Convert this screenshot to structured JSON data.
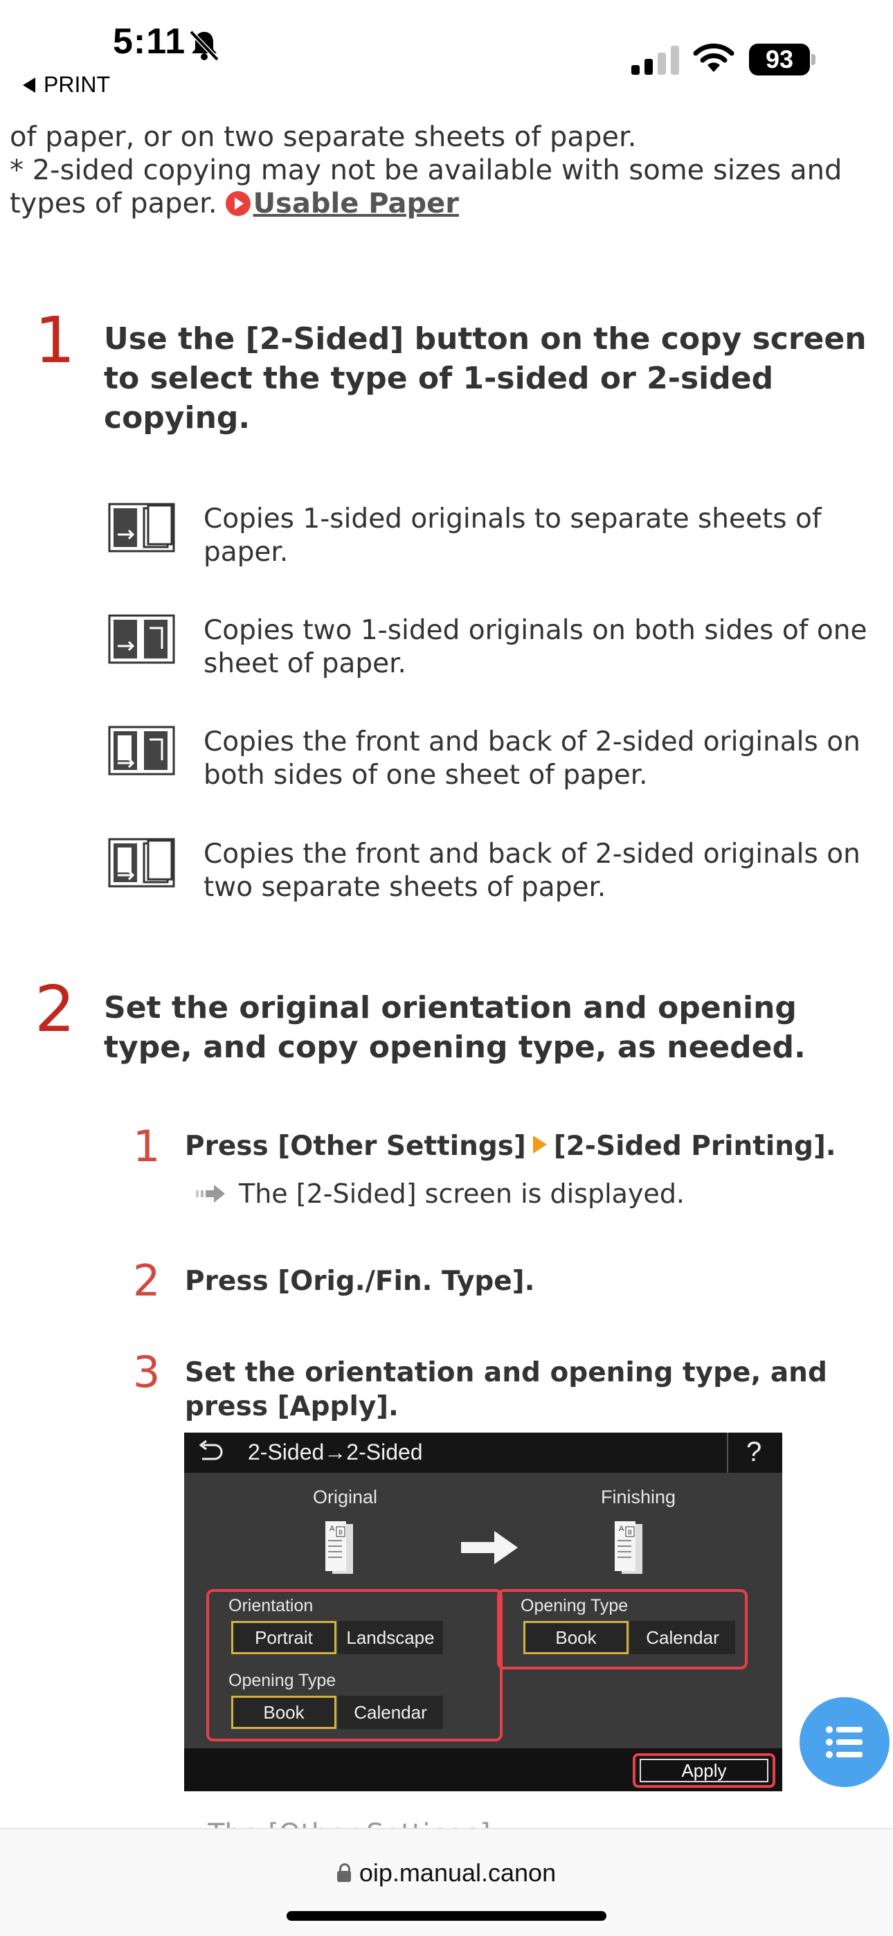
{
  "status_bar": {
    "time": "5:11",
    "back_label": "PRINT",
    "battery": "93"
  },
  "intro": {
    "line1": "of paper, or on two separate sheets of paper.",
    "line2": "* 2-sided copying may not be available with some sizes and types of paper.",
    "link": "Usable Paper"
  },
  "step1": {
    "number": "1",
    "title": "Use the [2-Sided] button on the copy screen to select the type of 1-sided or 2-sided copying.",
    "options": [
      {
        "icon": "1-to-1-sided-icon",
        "text": "Copies 1-sided originals to separate sheets of paper."
      },
      {
        "icon": "1-to-2-sided-icon",
        "text": "Copies two 1-sided originals on both sides of one sheet of paper."
      },
      {
        "icon": "2-to-2-sided-icon",
        "text": "Copies the front and back of 2-sided originals on both sides of one sheet of paper."
      },
      {
        "icon": "2-to-1-sided-icon",
        "text": "Copies the front and back of 2-sided originals on two separate sheets of paper."
      }
    ]
  },
  "step2": {
    "number": "2",
    "title": "Set the original orientation and opening type, and copy opening type, as needed.",
    "substeps": [
      {
        "number": "1",
        "text_a": "Press [Other Settings]",
        "text_b": "[2-Sided Printing].",
        "result": "The [2-Sided] screen is displayed."
      },
      {
        "number": "2",
        "text": "Press [Orig./Fin. Type]."
      },
      {
        "number": "3",
        "text": "Set the orientation and opening type, and press [Apply]."
      }
    ]
  },
  "device_screen": {
    "title": "2-Sided→2-Sided",
    "help": "?",
    "original_label": "Original",
    "finishing_label": "Finishing",
    "orientation_label": "Orientation",
    "orientation_options": [
      "Portrait",
      "Landscape"
    ],
    "orig_opening_label": "Opening Type",
    "orig_opening_options": [
      "Book",
      "Calendar"
    ],
    "fin_opening_label": "Opening Type",
    "fin_opening_options": [
      "Book",
      "Calendar"
    ],
    "apply_label": "Apply"
  },
  "browser": {
    "url": "oip.manual.canon",
    "cut_text": "The [Other Settings]"
  },
  "colors": {
    "step_red": "#c0281f",
    "accent_orange": "#f29a1c",
    "link_red": "#e8413c",
    "fab_blue": "#4aa3ec",
    "highlight_red": "#e8404a"
  }
}
